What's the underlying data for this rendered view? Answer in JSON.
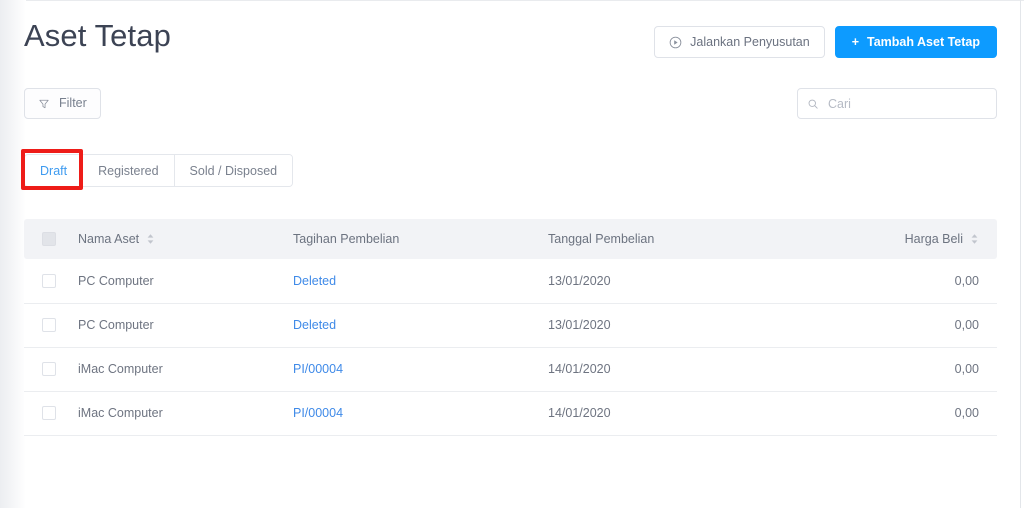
{
  "header": {
    "title": "Aset Tetap",
    "depreciation_button": "Jalankan Penyusutan",
    "add_button": "Tambah Aset Tetap",
    "add_button_plus": "+",
    "play_icon": "play-circle-icon",
    "primary_color": "#0d9bff"
  },
  "toolbar": {
    "filter_label": "Filter",
    "filter_icon": "funnel-icon",
    "search_placeholder": "Cari",
    "search_value": "",
    "search_icon": "search-icon"
  },
  "tabs": {
    "items": [
      {
        "label": "Draft",
        "active": true
      },
      {
        "label": "Registered",
        "active": false
      },
      {
        "label": "Sold / Disposed",
        "active": false
      }
    ],
    "highlight_color": "#ee1c18",
    "active_color": "#3e9bf0"
  },
  "table": {
    "columns": [
      {
        "key": "check",
        "label": "",
        "sortable": false
      },
      {
        "key": "name",
        "label": "Nama Aset",
        "sortable": true
      },
      {
        "key": "bill",
        "label": "Tagihan Pembelian",
        "sortable": false
      },
      {
        "key": "date",
        "label": "Tanggal Pembelian",
        "sortable": false
      },
      {
        "key": "price",
        "label": "Harga Beli",
        "sortable": true
      }
    ],
    "rows": [
      {
        "name": "PC Computer",
        "bill": "Deleted",
        "date": "13/01/2020",
        "price": "0,00"
      },
      {
        "name": "PC Computer",
        "bill": "Deleted",
        "date": "13/01/2020",
        "price": "0,00"
      },
      {
        "name": "iMac Computer",
        "bill": "PI/00004",
        "date": "14/01/2020",
        "price": "0,00"
      },
      {
        "name": "iMac Computer",
        "bill": "PI/00004",
        "date": "14/01/2020",
        "price": "0,00"
      }
    ],
    "link_color": "#3f8ae8"
  }
}
